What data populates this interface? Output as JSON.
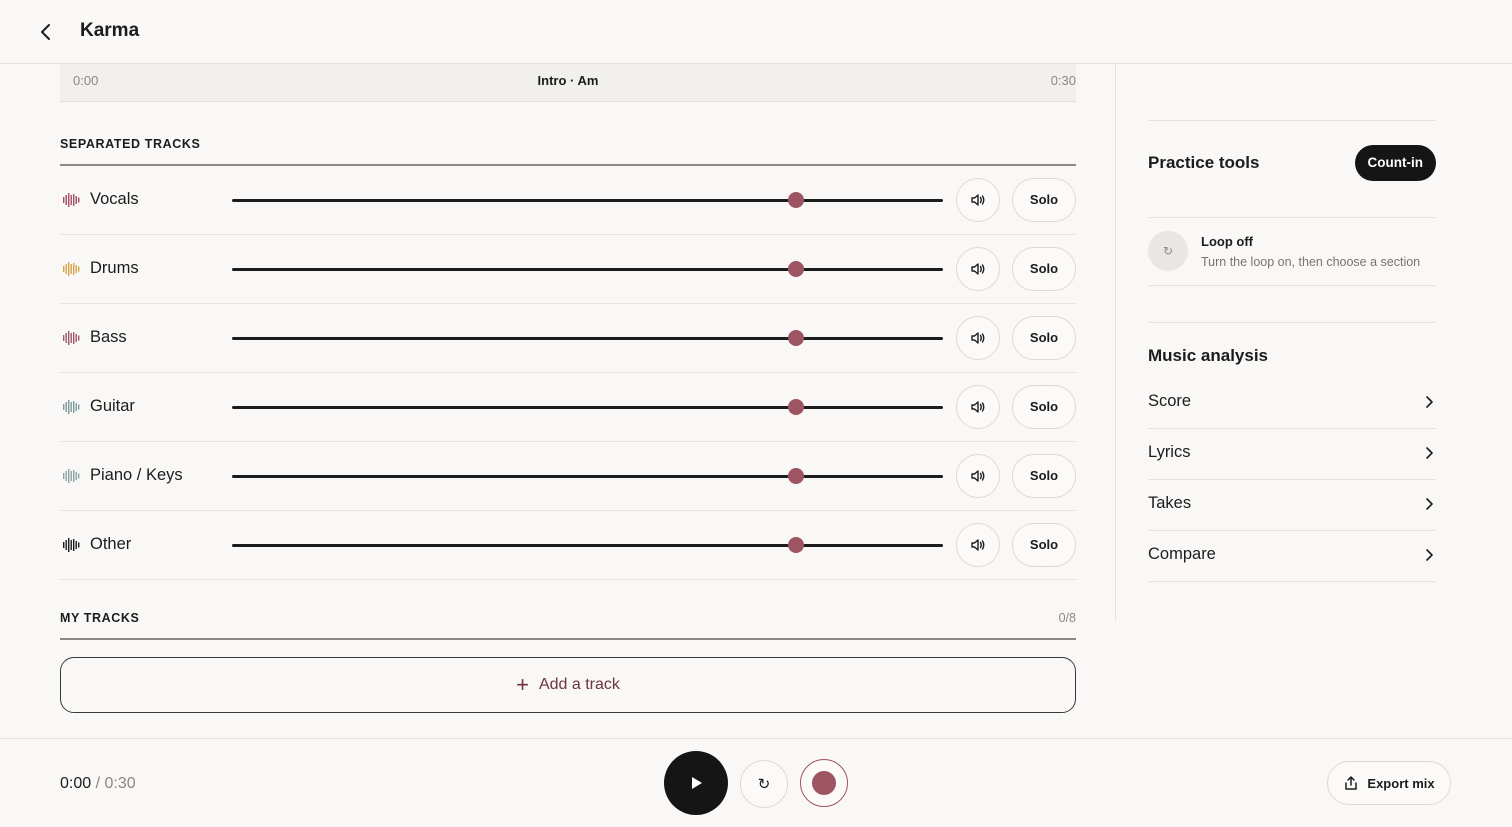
{
  "header": {
    "title": "Karma"
  },
  "timeline": {
    "start": "0:00",
    "section": "Intro · Am",
    "end": "0:30"
  },
  "separated": {
    "label": "SEPARATED TRACKS",
    "tracks": [
      {
        "name": "Vocals",
        "volume": 0.793,
        "color": "#a34e60",
        "mute_icon": "speaker-icon",
        "solo_label": "Solo"
      },
      {
        "name": "Drums",
        "volume": 0.793,
        "color": "#d9a448",
        "mute_icon": "speaker-icon",
        "solo_label": "Solo"
      },
      {
        "name": "Bass",
        "volume": 0.793,
        "color": "#a05868",
        "mute_icon": "speaker-icon",
        "solo_label": "Solo"
      },
      {
        "name": "Guitar",
        "volume": 0.793,
        "color": "#7e9a98",
        "mute_icon": "speaker-icon",
        "solo_label": "Solo"
      },
      {
        "name": "Piano / Keys",
        "volume": 0.793,
        "color": "#8aa4a2",
        "mute_icon": "speaker-icon",
        "solo_label": "Solo"
      },
      {
        "name": "Other",
        "volume": 0.793,
        "color": "#1c1c1c",
        "mute_icon": "speaker-icon",
        "solo_label": "Solo"
      }
    ]
  },
  "my_tracks": {
    "label": "MY TRACKS",
    "count": "0/8",
    "add_label": "Add a track"
  },
  "practice": {
    "title": "Practice tools",
    "countin_label": "Count-in",
    "loop_title": "Loop off",
    "loop_sub": "Turn the loop on, then choose a section"
  },
  "analysis": {
    "title": "Music analysis",
    "items": [
      {
        "label": "Score"
      },
      {
        "label": "Lyrics"
      },
      {
        "label": "Takes"
      },
      {
        "label": "Compare"
      }
    ]
  },
  "player": {
    "current": "0:00",
    "separator": " / ",
    "total": "0:30",
    "export_label": "Export mix"
  },
  "colors": {
    "accent": "#9e5563",
    "dark": "#151515",
    "background": "#f9f8f6"
  }
}
